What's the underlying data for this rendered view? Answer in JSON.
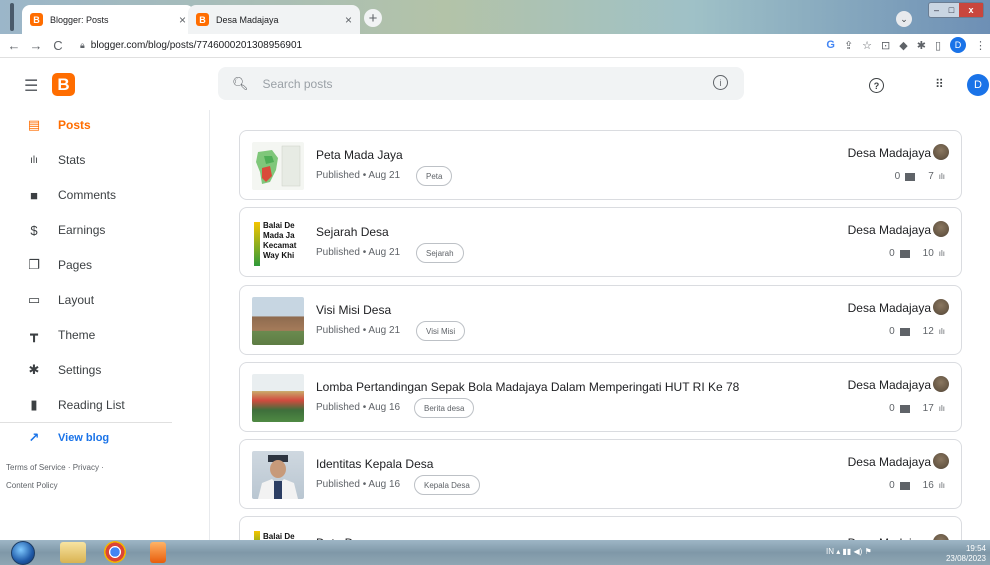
{
  "browser": {
    "tabs": [
      {
        "title": "Blogger: Posts",
        "icon": "B",
        "active": true
      },
      {
        "title": "Desa Madajaya",
        "icon": "B",
        "active": false
      }
    ],
    "url": "blogger.com/blog/posts/7746000201308956901",
    "profile_initial": "D"
  },
  "header": {
    "logo": "B",
    "search_placeholder": "Search posts",
    "avatar_initial": "D"
  },
  "sidebar": {
    "items": [
      {
        "label": "Posts",
        "icon": "posts-icon",
        "glyph": "▤",
        "active": true
      },
      {
        "label": "Stats",
        "icon": "stats-icon",
        "glyph": "ılı"
      },
      {
        "label": "Comments",
        "icon": "comments-icon",
        "glyph": "■"
      },
      {
        "label": "Earnings",
        "icon": "earnings-icon",
        "glyph": "$"
      },
      {
        "label": "Pages",
        "icon": "pages-icon",
        "glyph": "❐"
      },
      {
        "label": "Layout",
        "icon": "layout-icon",
        "glyph": "▭"
      },
      {
        "label": "Theme",
        "icon": "theme-icon",
        "glyph": "┳"
      },
      {
        "label": "Settings",
        "icon": "settings-icon",
        "glyph": "✱"
      },
      {
        "label": "Reading List",
        "icon": "reading-list-icon",
        "glyph": "▮"
      }
    ],
    "view_blog": "View blog",
    "footer": {
      "terms": "Terms of Service",
      "sep": "·",
      "privacy": "Privacy",
      "content_policy": "Content Policy"
    }
  },
  "posts": [
    {
      "title": "Peta Mada Jaya",
      "status": "Published • Aug 21",
      "label": "Peta",
      "author": "Desa Madajaya",
      "comments": "0",
      "views": "7"
    },
    {
      "title": "Sejarah Desa",
      "status": "Published • Aug 21",
      "label": "Sejarah",
      "author": "Desa Madajaya",
      "comments": "0",
      "views": "10"
    },
    {
      "title": "Visi Misi Desa",
      "status": "Published • Aug 21",
      "label": "Visi Misi",
      "author": "Desa Madajaya",
      "comments": "0",
      "views": "12"
    },
    {
      "title": "Lomba Pertandingan Sepak Bola Madajaya Dalam Memperingati HUT RI Ke 78",
      "status": "Published • Aug 16",
      "label": "Berita desa",
      "author": "Desa Madajaya",
      "comments": "0",
      "views": "17"
    },
    {
      "title": "Identitas Kepala Desa",
      "status": "Published • Aug 16",
      "label": "Kepala Desa",
      "author": "Desa Madajaya",
      "comments": "0",
      "views": "16"
    },
    {
      "title": "Data Dusun",
      "status": "",
      "label": "",
      "author": "Desa Madajaya",
      "comments": "",
      "views": ""
    }
  ],
  "thumb_texts": {
    "sejarah": [
      "Balai De",
      "Mada Ja",
      "Kecamat",
      "Way Khi"
    ],
    "data_dusun": "Balai De"
  },
  "taskbar": {
    "lang": "IN",
    "time": "19:54",
    "date": "23/08/2023"
  },
  "colors": {
    "accent": "#ff6d00",
    "link": "#1a73e8"
  }
}
